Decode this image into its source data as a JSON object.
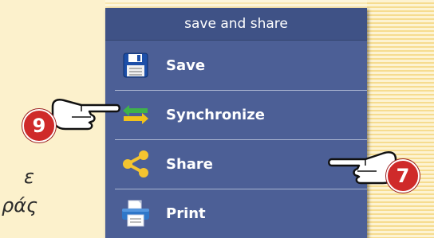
{
  "panel": {
    "title": "save and share",
    "items": [
      {
        "label": "Save",
        "icon": "floppy-disk-icon"
      },
      {
        "label": "Synchronize",
        "icon": "sync-arrows-icon"
      },
      {
        "label": "Share",
        "icon": "share-icon"
      },
      {
        "label": "Print",
        "icon": "printer-icon"
      }
    ]
  },
  "callouts": [
    {
      "number": "9",
      "points_to": "Synchronize"
    },
    {
      "number": "7",
      "points_to": "Share"
    }
  ],
  "background_text": [
    "ε",
    "ράς"
  ],
  "colors": {
    "panel_bg": "#4c5f96",
    "header_bg": "#3f5286",
    "badge": "#cf2a2a",
    "paper": "#fbeec6"
  }
}
